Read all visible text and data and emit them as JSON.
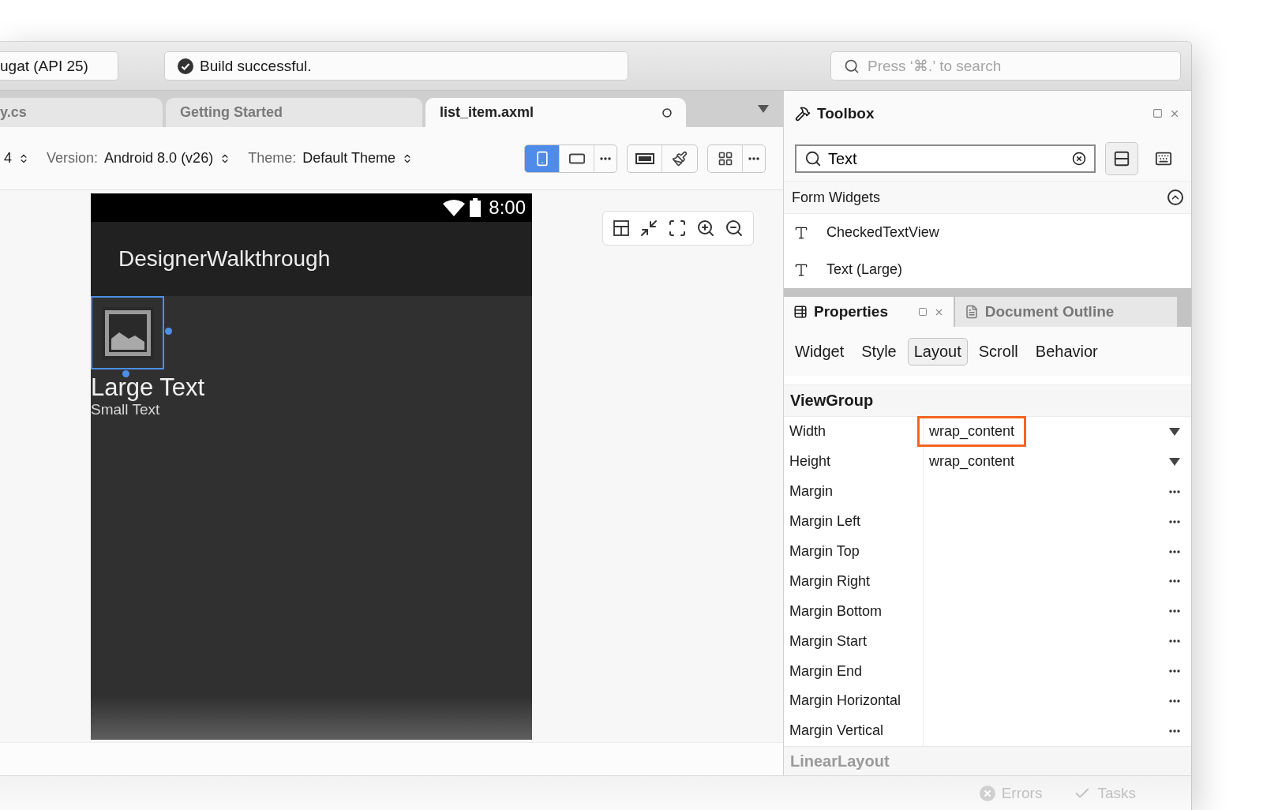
{
  "toolbar": {
    "device": "ugat (API 25)",
    "build_status": "Build successful.",
    "search": {
      "placeholder": "Press ‘⌘.’ to search"
    }
  },
  "tabs": [
    {
      "label": "y.cs",
      "selected": false
    },
    {
      "label": "Getting Started",
      "selected": false
    },
    {
      "label": "list_item.axml",
      "selected": true
    }
  ],
  "designer_toolbar": {
    "api": "4",
    "fields": [
      {
        "label": "Version:",
        "value": "Android 8.0 (v26)"
      },
      {
        "label": "Theme:",
        "value": "Default Theme"
      }
    ],
    "orientation": [
      {
        "kind": "portrait",
        "selected": true
      },
      {
        "kind": "landscape",
        "selected": false
      }
    ]
  },
  "phone": {
    "time": "8:00",
    "app_title": "DesignerWalkthrough",
    "large_text": "Large Text",
    "small_text": "Small Text"
  },
  "toolbox": {
    "title": "Toolbox",
    "search_value": "Text",
    "category": "Form Widgets",
    "expanded": true,
    "items": [
      "CheckedTextView",
      "Text (Large)"
    ]
  },
  "properties": {
    "tabs": [
      {
        "label": "Properties",
        "selected": true
      },
      {
        "label": "Document Outline",
        "selected": false
      }
    ],
    "subtabs": [
      {
        "label": "Widget",
        "selected": false
      },
      {
        "label": "Style",
        "selected": false
      },
      {
        "label": "Layout",
        "selected": true
      },
      {
        "label": "Scroll",
        "selected": false
      },
      {
        "label": "Behavior",
        "selected": false
      }
    ],
    "sections": [
      {
        "title": "ViewGroup",
        "rows": [
          {
            "label": "Width",
            "value": "wrap_content",
            "kind": "dropdown",
            "highlighted": true
          },
          {
            "label": "Height",
            "value": "wrap_content",
            "kind": "dropdown",
            "highlighted": false
          },
          {
            "label": "Margin",
            "kind": "dialog"
          },
          {
            "label": "Margin Left",
            "kind": "dialog"
          },
          {
            "label": "Margin Top",
            "kind": "dialog"
          },
          {
            "label": "Margin Right",
            "kind": "dialog"
          },
          {
            "label": "Margin Bottom",
            "kind": "dialog"
          },
          {
            "label": "Margin Start",
            "kind": "dialog"
          },
          {
            "label": "Margin End",
            "kind": "dialog"
          },
          {
            "label": "Margin Horizontal",
            "kind": "dialog"
          },
          {
            "label": "Margin Vertical",
            "kind": "dialog"
          }
        ]
      },
      {
        "title": "LinearLayout"
      }
    ]
  },
  "status_bar": [
    {
      "label": "Errors",
      "kind": "errors",
      "disabled": true
    },
    {
      "label": "Tasks",
      "kind": "tasks",
      "disabled": true
    }
  ]
}
